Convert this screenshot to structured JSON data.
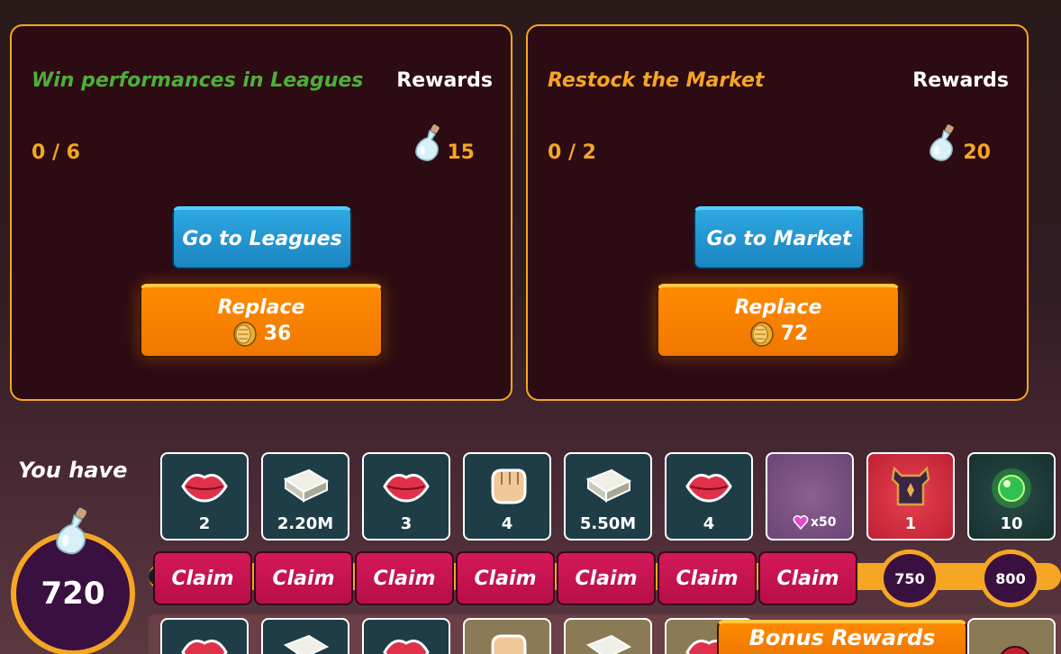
{
  "missions": [
    {
      "title": "Win performances in Leagues",
      "rewards_label": "Rewards",
      "progress": "0 / 6",
      "reward_amount": "15",
      "goto_label": "Go to Leagues",
      "replace_label": "Replace",
      "replace_cost": "36",
      "title_color": "#4caf3a"
    },
    {
      "title": "Restock the Market",
      "rewards_label": "Rewards",
      "progress": "0 / 2",
      "reward_amount": "20",
      "goto_label": "Go to Market",
      "replace_label": "Replace",
      "replace_cost": "72",
      "title_color": "#f5a623"
    }
  ],
  "balance": {
    "label": "You have",
    "amount": "720"
  },
  "track": {
    "tiles": [
      {
        "icon": "lips-icon",
        "count": "2"
      },
      {
        "icon": "cash-stack-icon",
        "count": "2.20M"
      },
      {
        "icon": "lips-icon",
        "count": "3"
      },
      {
        "icon": "fist-icon",
        "count": "4"
      },
      {
        "icon": "cash-stack-icon",
        "count": "5.50M"
      },
      {
        "icon": "lips-icon",
        "count": "4"
      },
      {
        "icon": "gem-heart-icon",
        "count": "x50"
      },
      {
        "icon": "armor-icon",
        "count": "1"
      },
      {
        "icon": "green-orb-icon",
        "count": "10"
      }
    ],
    "claim_labels": [
      "Claim",
      "Claim",
      "Claim",
      "Claim",
      "Claim",
      "Claim",
      "Claim"
    ],
    "milestones": [
      "750",
      "800"
    ]
  },
  "bonus": {
    "label": "Bonus Rewards"
  },
  "colors": {
    "accent": "#f5a623",
    "claim": "#c8144f",
    "goto": "#1a85c2",
    "replace": "#ff8a00"
  }
}
